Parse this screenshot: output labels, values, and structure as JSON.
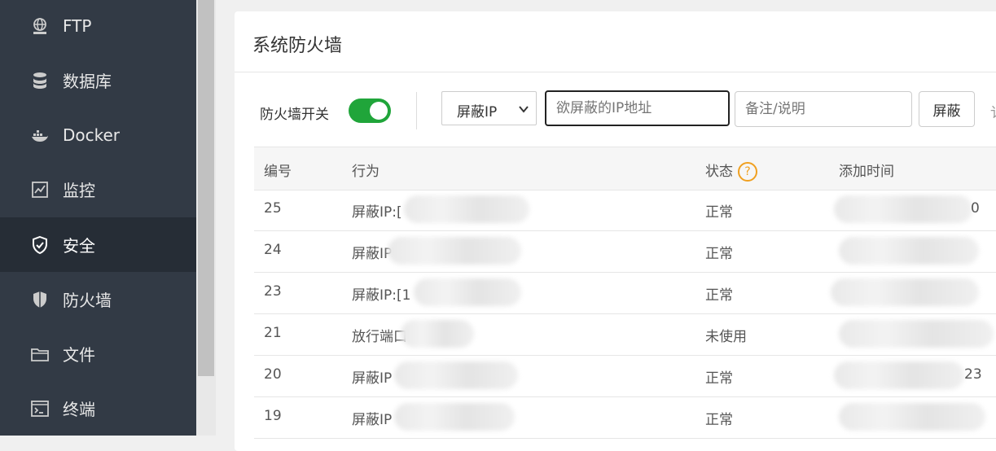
{
  "sidebar": {
    "items": [
      {
        "label": "FTP",
        "icon": "ftp-icon"
      },
      {
        "label": "数据库",
        "icon": "database-icon"
      },
      {
        "label": "Docker",
        "icon": "docker-icon"
      },
      {
        "label": "监控",
        "icon": "monitor-icon"
      },
      {
        "label": "安全",
        "icon": "shield-icon",
        "active": true
      },
      {
        "label": "防火墙",
        "icon": "firewall-icon"
      },
      {
        "label": "文件",
        "icon": "folder-icon"
      },
      {
        "label": "终端",
        "icon": "terminal-icon"
      }
    ]
  },
  "panel": {
    "title": "系统防火墙",
    "toggle_label": "防火墙开关",
    "toggle_on": true,
    "select_value": "屏蔽IP",
    "ip_placeholder": "欲屏蔽的IP地址",
    "note_placeholder": "备注/说明",
    "block_button": "屏蔽",
    "clipped_text": "讠"
  },
  "table": {
    "headers": [
      "编号",
      "行为",
      "状态",
      "添加时间"
    ],
    "rows": [
      {
        "id": "25",
        "action": "屏蔽IP:[",
        "status": "正常",
        "time": "0"
      },
      {
        "id": "24",
        "action": "屏蔽IP",
        "status": "正常",
        "time": ""
      },
      {
        "id": "23",
        "action": "屏蔽IP:[1",
        "status": "正常",
        "time": ""
      },
      {
        "id": "21",
        "action": "放行端口",
        "status": "未使用",
        "time": ""
      },
      {
        "id": "20",
        "action": "屏蔽IP",
        "status": "正常",
        "time": "23"
      },
      {
        "id": "19",
        "action": "屏蔽IP",
        "status": "正常",
        "time": ""
      }
    ]
  },
  "colors": {
    "sidebar_bg": "#323a45",
    "active_bg": "#262d36",
    "toggle_on": "#20a53a",
    "help_icon": "#f0a020"
  }
}
